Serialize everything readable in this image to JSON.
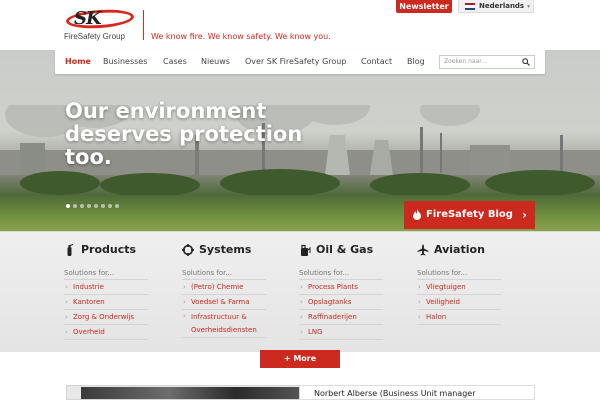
{
  "header": {
    "logo_text": "SK",
    "logo_sub": "FireSafety Group",
    "tagline": "We know fire. We know safety. We know you.",
    "newsletter_label": "Newsletter",
    "language": "Nederlands"
  },
  "nav": {
    "items": [
      {
        "label": "Home",
        "active": true
      },
      {
        "label": "Businesses"
      },
      {
        "label": "Cases"
      },
      {
        "label": "Nieuws"
      },
      {
        "label": "Over SK FireSafety Group"
      },
      {
        "label": "Contact"
      },
      {
        "label": "Blog"
      }
    ],
    "search_placeholder": "Zoeken naar..."
  },
  "hero": {
    "title": "Our environment deserves protection too.",
    "slide_count": 8,
    "active_slide": 1,
    "blog_button": "FireSafety Blog"
  },
  "categories": [
    {
      "title": "Products",
      "icon": "fire-extinguisher-icon",
      "sub": "Solutions for...",
      "links": [
        "Industrie",
        "Kantoren",
        "Zorg & Onderwijs",
        "Overheid"
      ]
    },
    {
      "title": "Systems",
      "icon": "crosshair-icon",
      "sub": "Solutions for...",
      "links": [
        "(Petro) Chemie",
        "Voedsel & Farma",
        "Infrastructuur & Overheidsdiensten"
      ]
    },
    {
      "title": "Oil & Gas",
      "icon": "fuel-can-icon",
      "sub": "Solutions for...",
      "links": [
        "Process Plants",
        "Opslagtanks",
        "Raffinaderijen",
        "LNG"
      ]
    },
    {
      "title": "Aviation",
      "icon": "airplane-icon",
      "sub": "Solutions for...",
      "links": [
        "Vliegtuigen",
        "Veiligheid",
        "Halon"
      ]
    }
  ],
  "more_button": "+ More",
  "teaser": {
    "text": "Norbert Alberse (Business Unit manager"
  },
  "colors": {
    "brand_red": "#cc2a1e",
    "band_bg": "#e9e9e9"
  }
}
